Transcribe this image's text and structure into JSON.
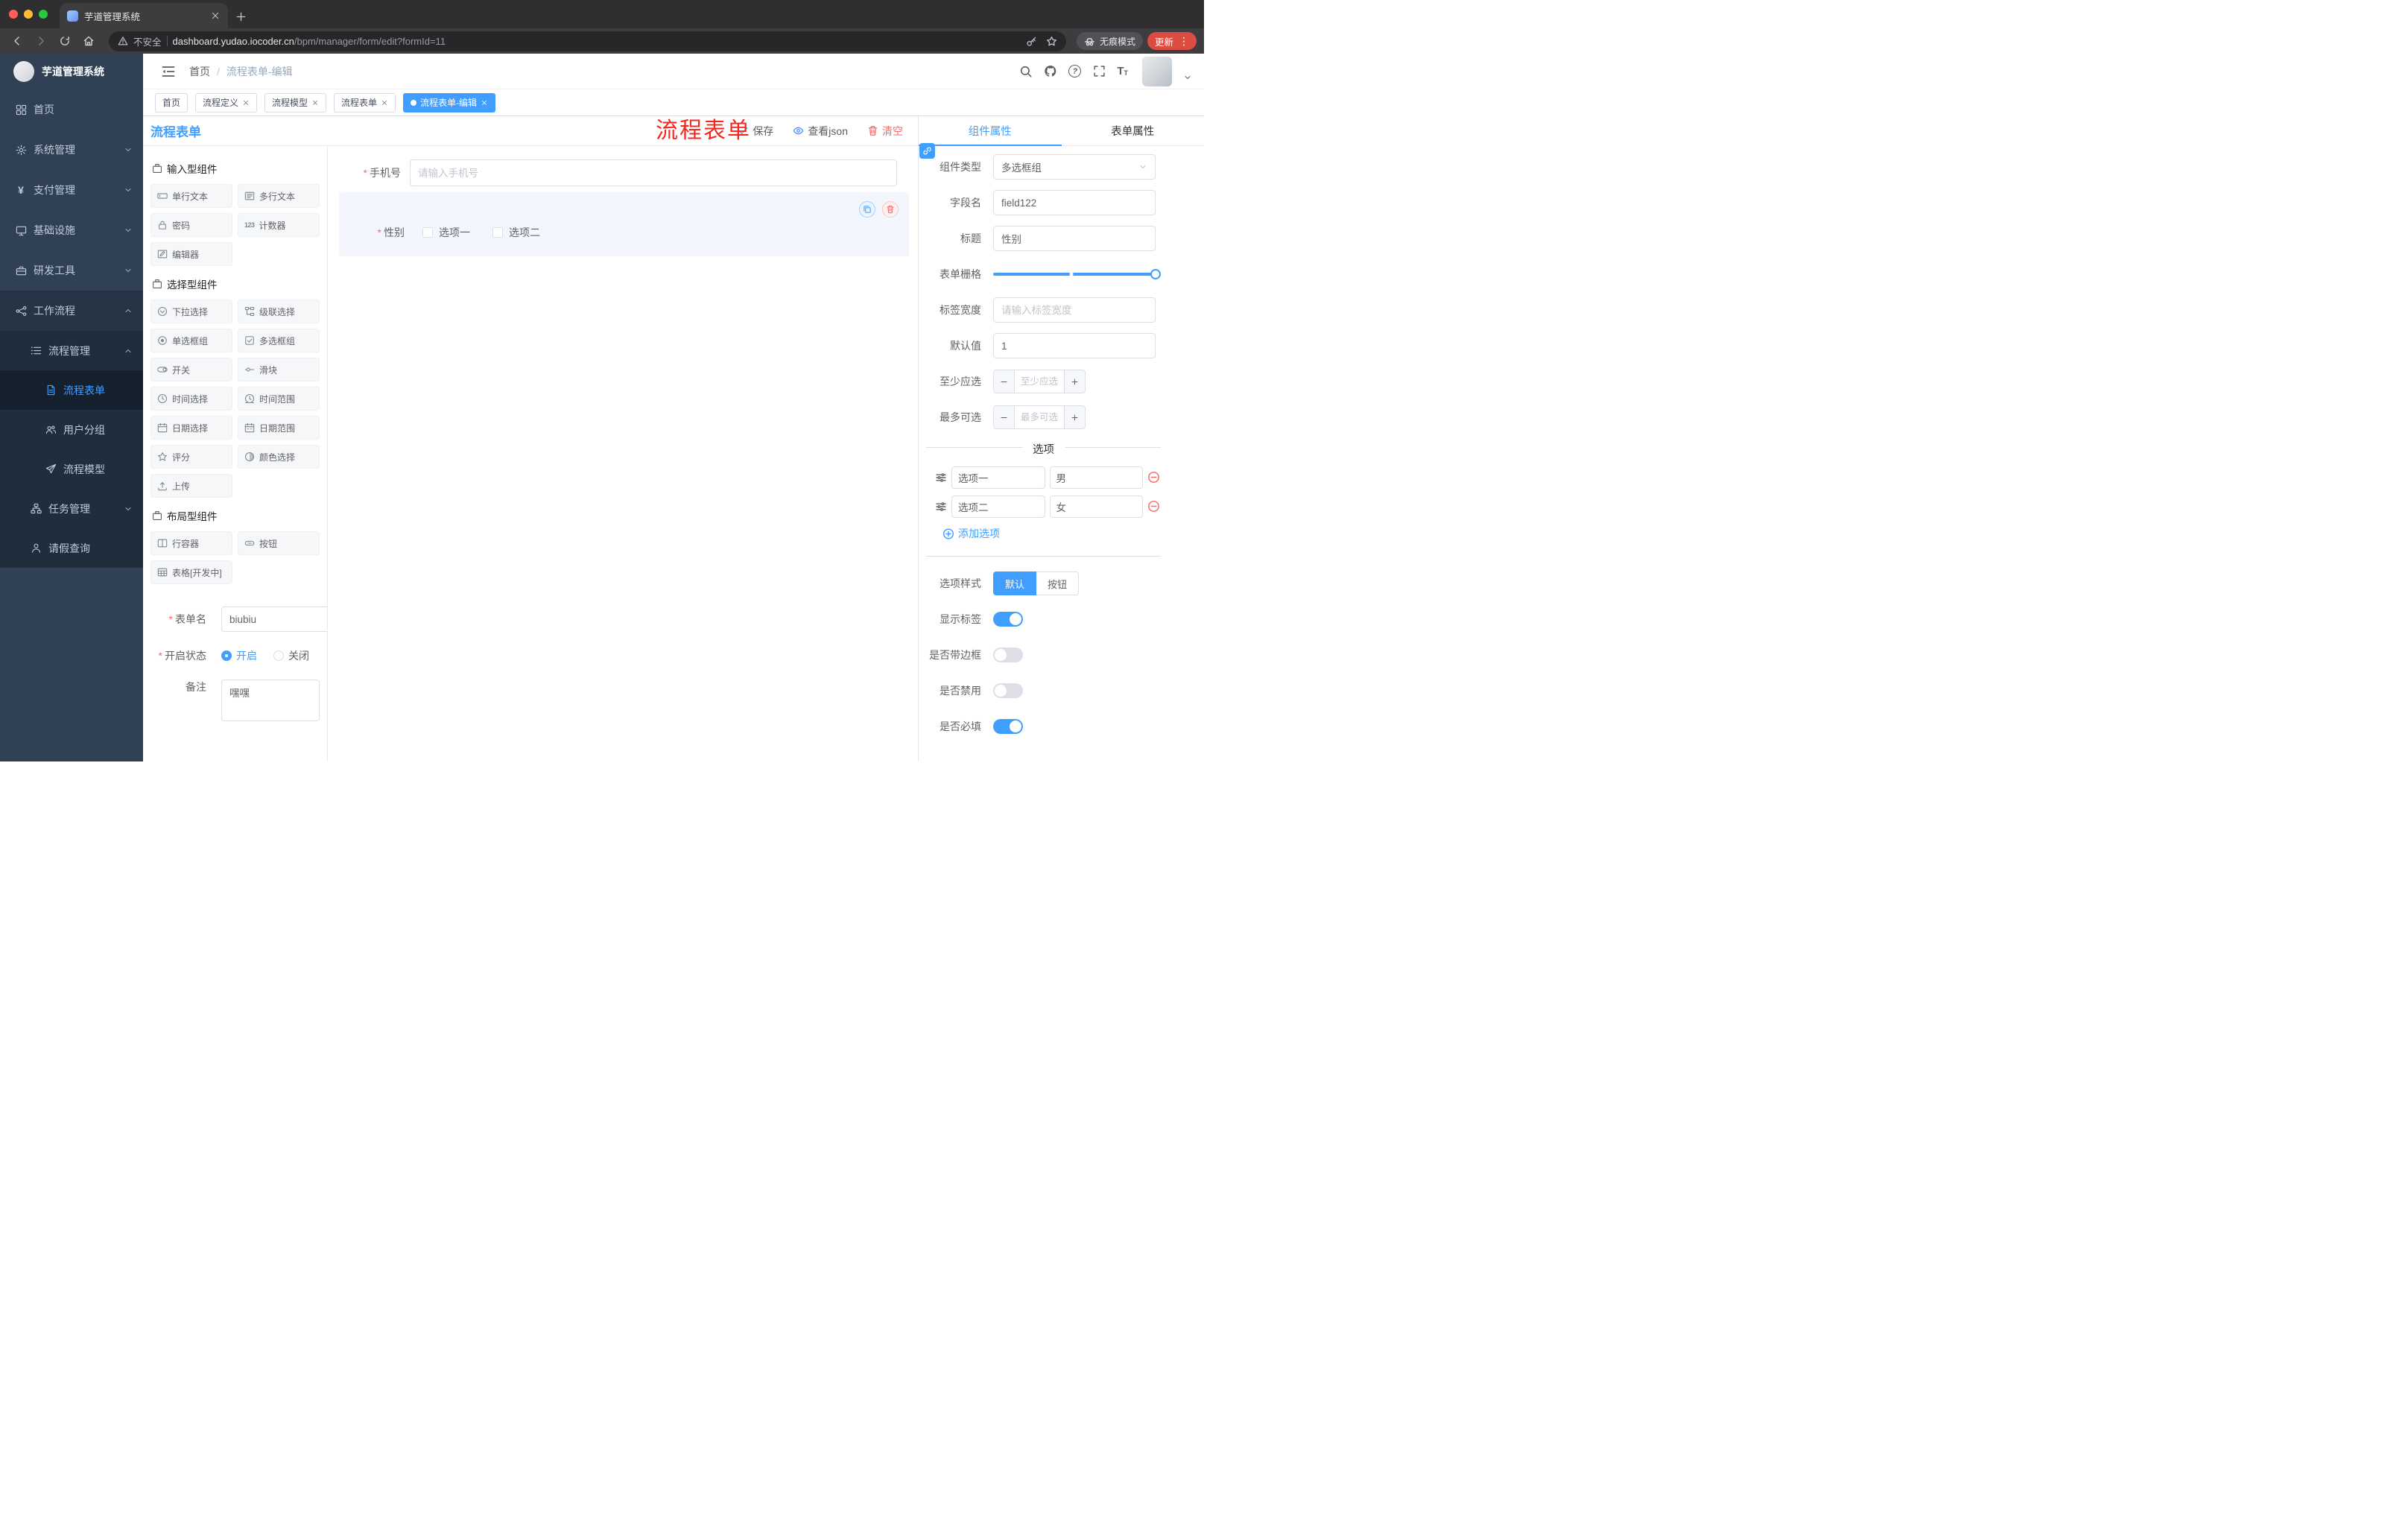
{
  "browser": {
    "tab_title": "芋道管理系统",
    "security_label": "不安全",
    "url_domain": "dashboard.yudao.iocoder.cn",
    "url_path": "/bpm/manager/form/edit?formId=11",
    "incognito_label": "无痕模式",
    "update_label": "更新"
  },
  "icons": {
    "yen": "¥",
    "counter": "123",
    "font_size": "T",
    "close": "×",
    "kebab": "⋮",
    "question": "?",
    "breadcrumb_sep": "/"
  },
  "sidebar": {
    "logo_title": "芋道管理系统",
    "menu": [
      {
        "label": "首页"
      },
      {
        "label": "系统管理"
      },
      {
        "label": "支付管理"
      },
      {
        "label": "基础设施"
      },
      {
        "label": "研发工具"
      },
      {
        "label": "工作流程"
      },
      {
        "label": "流程管理"
      },
      {
        "label": "流程表单"
      },
      {
        "label": "用户分组"
      },
      {
        "label": "流程模型"
      },
      {
        "label": "任务管理"
      },
      {
        "label": "请假查询"
      }
    ],
    "active_item": "流程表单"
  },
  "header": {
    "breadcrumb": [
      "首页",
      "流程表单-编辑"
    ],
    "annotation": "流程表单"
  },
  "tags": [
    {
      "label": "首页",
      "closable": false,
      "active": false
    },
    {
      "label": "流程定义",
      "closable": true,
      "active": false
    },
    {
      "label": "流程模型",
      "closable": true,
      "active": false
    },
    {
      "label": "流程表单",
      "closable": true,
      "active": false
    },
    {
      "label": "流程表单-编辑",
      "closable": true,
      "active": true
    }
  ],
  "designer": {
    "title": "流程表单",
    "actions": {
      "save": "保存",
      "view_json": "查看json",
      "clear": "清空"
    },
    "palette": {
      "sections": [
        {
          "title": "输入型组件",
          "items": [
            "单行文本",
            "多行文本",
            "密码",
            "计数器",
            "编辑器"
          ]
        },
        {
          "title": "选择型组件",
          "items": [
            "下拉选择",
            "级联选择",
            "单选框组",
            "多选框组",
            "开关",
            "滑块",
            "时间选择",
            "时间范围",
            "日期选择",
            "日期范围",
            "评分",
            "颜色选择",
            "上传"
          ]
        },
        {
          "title": "布局型组件",
          "items": [
            "行容器",
            "按钮",
            "表格[开发中]"
          ]
        }
      ]
    },
    "meta": {
      "form_name_label": "表单名",
      "form_name_value": "biubiu",
      "status_label": "开启状态",
      "status_on": "开启",
      "status_off": "关闭",
      "status_selected": "开启",
      "remark_label": "备注",
      "remark_value": "嘿嘿"
    },
    "canvas": {
      "phone": {
        "label": "手机号",
        "required": true,
        "placeholder": "请输入手机号"
      },
      "gender": {
        "label": "性别",
        "required": true,
        "option1": "选项一",
        "option2": "选项二",
        "selected": true
      }
    }
  },
  "props": {
    "tab_component": "组件属性",
    "tab_form": "表单属性",
    "active_tab": "组件属性",
    "component_type_label": "组件类型",
    "component_type_value": "多选框组",
    "field_name_label": "字段名",
    "field_name_value": "field122",
    "title_label": "标题",
    "title_value": "性别",
    "grid_label": "表单栅格",
    "grid": {
      "fill": "100%",
      "stop_left": "48%"
    },
    "label_width_label": "标签宽度",
    "label_width_placeholder": "请输入标签宽度",
    "default_label": "默认值",
    "default_value": "1",
    "min_label": "至少应选",
    "min_placeholder": "至少应选",
    "max_label": "最多可选",
    "max_placeholder": "最多可选",
    "options_title": "选项",
    "options": [
      {
        "label": "选项一",
        "value": "男"
      },
      {
        "label": "选项二",
        "value": "女"
      }
    ],
    "add_option_label": "添加选项",
    "option_style_label": "选项样式",
    "style_default": "默认",
    "style_button": "按钮",
    "style_selected": "默认",
    "toggles": [
      {
        "label": "显示标签",
        "on": true
      },
      {
        "label": "是否带边框",
        "on": false
      },
      {
        "label": "是否禁用",
        "on": false
      },
      {
        "label": "是否必填",
        "on": true
      }
    ]
  },
  "colors": {
    "accent": "#409eff",
    "danger": "#f56c6c",
    "annotation_red": "#f5261c",
    "sidebar_bg": "#304156",
    "submenu_bg": "#1f2d3d",
    "update_pill": "#dd4c41",
    "active_tag": "#409eff"
  }
}
